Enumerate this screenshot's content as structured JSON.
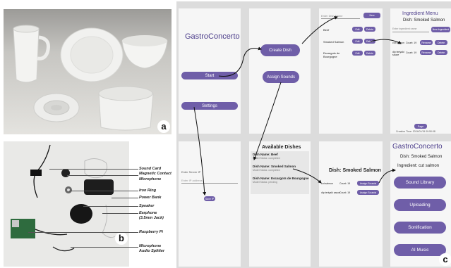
{
  "panel_a": {
    "badge": "a"
  },
  "panel_b": {
    "badge": "b",
    "callouts": [
      "Sound Card",
      "Magnetic Contact",
      "Microphone",
      "Iron Ring",
      "Power Bank",
      "Speaker",
      "Earphone",
      "(3.5mm Jack)",
      "Raspberry Pi",
      "Microphone",
      "Audio Splitter"
    ]
  },
  "panel_c": {
    "badge": "c",
    "app_title": "GastroConcerto",
    "start_button": "Start",
    "settings_button": "Settings",
    "create_dish_button": "Create Dish",
    "assign_sounds_button": "Assign Sounds",
    "dish_list": {
      "input_placeholder": "Enter Dish Name",
      "new_button": "New",
      "edit_label": "Edit",
      "delete_label": "Delete",
      "dishes": [
        "Beef",
        "Smoked Salmon",
        "Escargots de Bourgogne"
      ]
    },
    "ingredient_menu": {
      "title": "Ingredient Menu",
      "dish": "Dish: Smoked Salmon",
      "input_placeholder": "Enter ingredient name",
      "new_button": "New Ingredient",
      "rows": [
        {
          "name": "cut salmon",
          "count": "Count: 19",
          "a": "Rename",
          "b": "Delete"
        },
        {
          "name": "dip teriyaki sauce",
          "count": "Count: 19",
          "a": "Rename",
          "b": "Delete"
        }
      ],
      "page_button": "Page",
      "creation_time": "Creation Time: 2024/01/15 09:50:08"
    },
    "settings_screen": {
      "label": "Enter Server IP",
      "placeholder": "Enter IP address",
      "button": "Save IP"
    },
    "available_dishes": {
      "title": "Available Dishes",
      "items": [
        {
          "name": "Dish Name: Beef",
          "status": "Model Status: completed"
        },
        {
          "name": "Dish Name: Smoked Salmon",
          "status": "Model Status: completed"
        },
        {
          "name": "Dish Name: Escargots de Bourgogne",
          "status": "Model Status: pending"
        }
      ]
    },
    "dish_detail": {
      "title": "Dish: Smoked Salmon",
      "rows": [
        {
          "name": "cut salmon",
          "count": "Count: 19",
          "button": "Assign Sounds"
        },
        {
          "name": "dip teriyaki sauce",
          "count": "Count: 19",
          "button": "Assign Sounds"
        }
      ]
    },
    "sound_menu": {
      "app_title": "GastroConcerto",
      "dish": "Dish: Smoked Salmon",
      "ingredient": "Ingredient: cut salmon",
      "buttons": [
        "Sound Library",
        "Uploading",
        "Sonification",
        "AI Music"
      ]
    }
  }
}
